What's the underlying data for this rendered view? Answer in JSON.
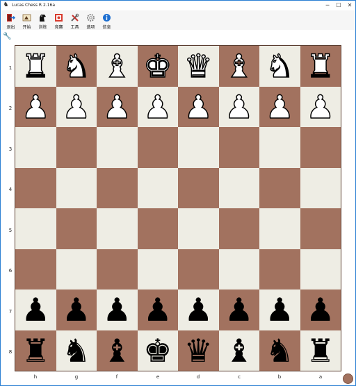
{
  "window": {
    "title": "Lucas Chess R 2.16a",
    "controls": [
      "─",
      "☐",
      "✕"
    ]
  },
  "toolbar": {
    "items": [
      {
        "id": "quit",
        "label": "退出",
        "icon": "exit-door-icon"
      },
      {
        "id": "play",
        "label": "开始",
        "icon": "play-icon"
      },
      {
        "id": "train",
        "label": "训练",
        "icon": "train-icon"
      },
      {
        "id": "compete",
        "label": "竞赛",
        "icon": "compete-icon"
      },
      {
        "id": "tools",
        "label": "工具",
        "icon": "tools-icon"
      },
      {
        "id": "options",
        "label": "选项",
        "icon": "gear-icon"
      },
      {
        "id": "info",
        "label": "信息",
        "icon": "info-icon"
      }
    ]
  },
  "board": {
    "ranks": [
      "1",
      "2",
      "3",
      "4",
      "5",
      "6",
      "7",
      "8"
    ],
    "files": [
      "h",
      "g",
      "f",
      "e",
      "d",
      "c",
      "b",
      "a"
    ],
    "rows": [
      [
        "♜",
        "♞",
        "♝",
        "♚",
        "♛",
        "♝",
        "♞",
        "♜"
      ],
      [
        "♟",
        "♟",
        "♟",
        "♟",
        "♟",
        "♟",
        "♟",
        "♟"
      ],
      [
        "",
        "",
        "",
        "",
        "",
        "",
        "",
        ""
      ],
      [
        "",
        "",
        "",
        "",
        "",
        "",
        "",
        ""
      ],
      [
        "",
        "",
        "",
        "",
        "",
        "",
        "",
        ""
      ],
      [
        "",
        "",
        "",
        "",
        "",
        "",
        "",
        ""
      ],
      [
        "♟",
        "♟",
        "♟",
        "♟",
        "♟",
        "♟",
        "♟",
        "♟"
      ],
      [
        "♜",
        "♞",
        "♝",
        "♚",
        "♛",
        "♝",
        "♞",
        "♜"
      ]
    ],
    "row_colors": [
      "white",
      "white",
      "",
      "",
      "",
      "",
      "black",
      "black"
    ],
    "light_color": "#eeede4",
    "dark_color": "#a2725f"
  },
  "turn_indicator_color": "#a2725f"
}
